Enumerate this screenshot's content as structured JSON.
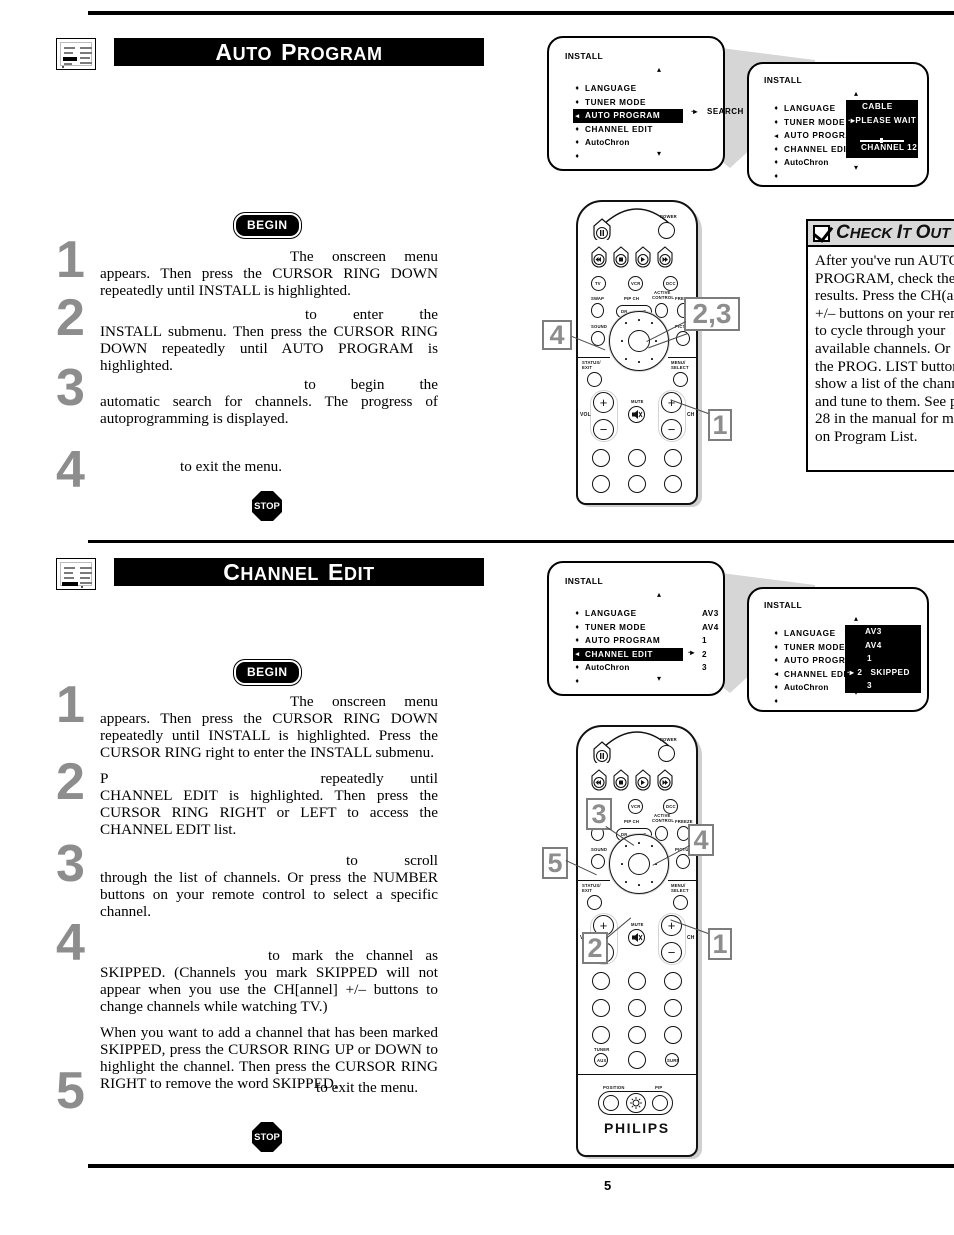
{
  "page": {
    "number": "5"
  },
  "sections": [
    {
      "id": "auto-program",
      "title_first": "A",
      "title_rest": "UTO",
      "title_first2": "P",
      "title_rest2": "ROGRAM",
      "begin_label": "BEGIN",
      "stop_label": "STOP",
      "steps": [
        {
          "num": "1",
          "text": "The onscreen menu appears. Then press the CURSOR RING DOWN repeatedly until INSTALL is highlighted."
        },
        {
          "num": "2",
          "text": "to enter the INSTALL submenu. Then press the CURSOR RING DOWN repeatedly until AUTO PROGRAM is highlighted."
        },
        {
          "num": "3",
          "text": "to begin the automatic search for channels. The progress of autoprogramming is displayed."
        },
        {
          "num": "4",
          "text": "to exit the menu."
        }
      ],
      "callouts": [
        "4",
        "2,3",
        "1"
      ],
      "menu1": {
        "title": "INSTALL",
        "rows": [
          {
            "label": "LANGUAGE",
            "highlight": false,
            "bullet": "♦"
          },
          {
            "label": "TUNER MODE",
            "highlight": false,
            "bullet": "♦"
          },
          {
            "label": "AUTO PROGRAM",
            "highlight": true,
            "bullet": "◂"
          },
          {
            "label": "CHANNEL EDIT",
            "highlight": false,
            "bullet": "♦"
          },
          {
            "label": "AutoChron",
            "highlight": false,
            "bullet": "♦"
          },
          {
            "label": "",
            "highlight": false,
            "bullet": "♦"
          }
        ],
        "side_arrow": "∙▸",
        "side_text": "SEARCH",
        "scroll_up": "▴",
        "scroll_down": "▾"
      },
      "menu2": {
        "title": "INSTALL",
        "rows": [
          {
            "label": "LANGUAGE",
            "bullet": "♦"
          },
          {
            "label": "TUNER MODE",
            "bullet": "♦"
          },
          {
            "label": "AUTO PROGRAM",
            "bullet": "◂"
          },
          {
            "label": "CHANNEL EDIT",
            "bullet": "♦"
          },
          {
            "label": "AutoChron",
            "bullet": "♦"
          },
          {
            "label": "",
            "bullet": "♦"
          }
        ],
        "panel": [
          {
            "text": "CABLE",
            "arrow": ""
          },
          {
            "text": "PLEASE WAIT",
            "arrow": "∙▸"
          },
          {
            "text": "",
            "arrow": ""
          },
          {
            "text": "CHANNEL  12",
            "arrow": ""
          }
        ],
        "scroll_up": "▴",
        "scroll_down": "▾"
      },
      "check_it_out": {
        "title_big": "C",
        "title_small": "HECK",
        "title_big2": "I",
        "title_small2": "T",
        "title_big3": "O",
        "title_small3": "UT",
        "body": "After you've run AUTO PROGRAM, check the results. Press the CH(annel) +/– buttons on your remote to cycle through your available channels. Or press the PROG. LIST button to show a list of the channels and tune to them. See page 28 in the          manual for more on Program List."
      }
    },
    {
      "id": "channel-edit",
      "title_first": "C",
      "title_rest": "HANNEL",
      "title_first2": "E",
      "title_rest2": "DIT",
      "begin_label": "BEGIN",
      "stop_label": "STOP",
      "steps": [
        {
          "num": "1",
          "text": "The onscreen menu appears. Then press the CURSOR RING DOWN repeatedly until INSTALL is highlighted. Press the CURSOR RING right to enter the INSTALL submenu."
        },
        {
          "num": "2",
          "text_lead": "P",
          "text": "repeatedly until CHANNEL EDIT is highlighted. Then press the CURSOR RING RIGHT or LEFT to access the CHANNEL EDIT list."
        },
        {
          "num": "3",
          "text": "to scroll through the list of channels. Or press the NUMBER buttons on your remote control to select a specific channel."
        },
        {
          "num": "4",
          "text": "to mark the channel as SKIPPED. (Channels you mark SKIPPED will not appear when you use the CH[annel] +/– buttons to change channels while watching TV.)",
          "extra": "When you want to add a channel that has been marked SKIPPED, press the CURSOR RING UP or DOWN to highlight the channel. Then press the CURSOR RING RIGHT to remove the word SKIPPED."
        },
        {
          "num": "5",
          "text": "to exit the menu."
        }
      ],
      "callouts": [
        "3",
        "4",
        "5",
        "2",
        "1"
      ],
      "menu1": {
        "title": "INSTALL",
        "rows": [
          {
            "label": "LANGUAGE",
            "highlight": false,
            "bullet": "♦",
            "value": "AV3"
          },
          {
            "label": "TUNER MODE",
            "highlight": false,
            "bullet": "♦",
            "value": "AV4"
          },
          {
            "label": "AUTO PROGRAM",
            "highlight": false,
            "bullet": "♦",
            "value": "1"
          },
          {
            "label": "CHANNEL EDIT",
            "highlight": true,
            "bullet": "◂",
            "value": "2"
          },
          {
            "label": "AutoChron",
            "highlight": false,
            "bullet": "♦",
            "value": "3"
          },
          {
            "label": "",
            "highlight": false,
            "bullet": "♦",
            "value": ""
          }
        ],
        "side_arrow": "∙▸",
        "scroll_up": "▴",
        "scroll_down": "▾"
      },
      "menu2": {
        "title": "INSTALL",
        "rows": [
          {
            "label": "LANGUAGE",
            "bullet": "♦"
          },
          {
            "label": "TUNER MODE",
            "bullet": "♦"
          },
          {
            "label": "AUTO PROGRAM",
            "bullet": "♦"
          },
          {
            "label": "CHANNEL EDIT",
            "bullet": "◂"
          },
          {
            "label": "AutoChron",
            "bullet": "♦"
          },
          {
            "label": "",
            "bullet": "♦"
          }
        ],
        "panel": [
          {
            "arrow": "",
            "num": "AV3",
            "note": ""
          },
          {
            "arrow": "",
            "num": "AV4",
            "note": ""
          },
          {
            "arrow": "",
            "num": "1",
            "note": ""
          },
          {
            "arrow": "∙▸",
            "num": "2",
            "note": "SKIPPED"
          },
          {
            "arrow": "",
            "num": "3",
            "note": ""
          }
        ],
        "scroll_up": "▴",
        "scroll_down": "▾"
      }
    }
  ],
  "remote": {
    "brand": "PHILIPS",
    "labels": {
      "power": "POWER",
      "tv": "TV",
      "vcr": "VCR",
      "dcc": "DCC",
      "swap": "SWAP",
      "pip_ch": "PIP CH",
      "dn": "DN",
      "up": "UP",
      "active_control_1": "ACTIVE",
      "active_control_2": "CONTROL",
      "freeze": "FREEZE",
      "sound": "SOUND",
      "picture": "PICTURE",
      "status_exit_1": "STATUS/",
      "status_exit_2": "EXIT",
      "menu_select_1": "MENU/",
      "menu_select_2": "SELECT",
      "vol": "VOL",
      "ch": "CH",
      "mute": "MUTE",
      "tuner": "TUNER",
      "aux": "AUX",
      "surf": "SURF",
      "position": "POSITION",
      "pip": "PIP"
    }
  }
}
